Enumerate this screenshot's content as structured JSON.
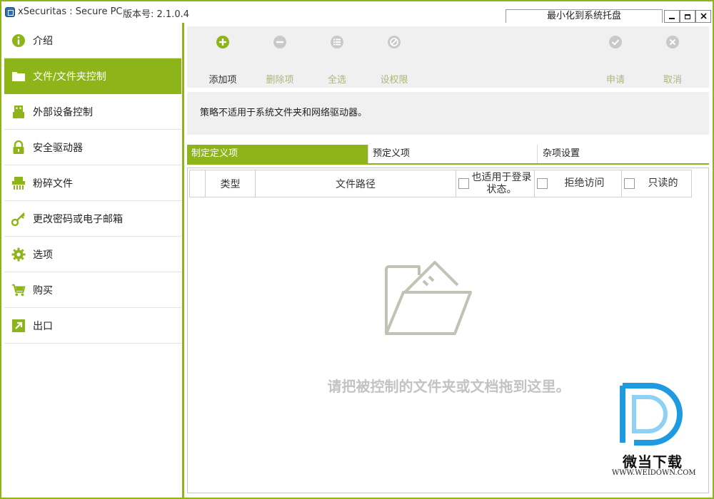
{
  "window": {
    "app_title": "xSecuritas : Secure PC",
    "version": "版本号: 2.1.0.4",
    "tray_button": "最小化到系统托盘",
    "accent_color": "#8db51a"
  },
  "sidebar": {
    "items": [
      {
        "label": "介绍",
        "icon": "info-icon",
        "active": false
      },
      {
        "label": "文件/文件夹控制",
        "icon": "folder-icon",
        "active": true
      },
      {
        "label": "外部设备控制",
        "icon": "usb-icon",
        "active": false
      },
      {
        "label": "安全驱动器",
        "icon": "lock-icon",
        "active": false
      },
      {
        "label": "粉碎文件",
        "icon": "shredder-icon",
        "active": false
      },
      {
        "label": "更改密码或电子邮箱",
        "icon": "key-icon",
        "active": false
      },
      {
        "label": "选项",
        "icon": "gear-icon",
        "active": false
      },
      {
        "label": "购买",
        "icon": "cart-icon",
        "active": false
      },
      {
        "label": "出口",
        "icon": "exit-icon",
        "active": false
      }
    ]
  },
  "toolbar": {
    "add": "添加项",
    "remove": "删除项",
    "select_all": "全选",
    "set_permission": "设权限",
    "apply": "申请",
    "cancel": "取消"
  },
  "notice": "策略不适用于系统文件夹和网络驱动器。",
  "tabs": [
    "制定定义项",
    "预定义项",
    "杂项设置"
  ],
  "table": {
    "columns": {
      "type": "类型",
      "path": "文件路径",
      "login_state": "也适用于登录状态。",
      "deny": "拒绝访问",
      "readonly": "只读的"
    },
    "empty_message": "请把被控制的文件夹或文档拖到这里。"
  },
  "watermark": {
    "name": "微当下载",
    "url": "WWW.WEIDOWN.COM"
  }
}
